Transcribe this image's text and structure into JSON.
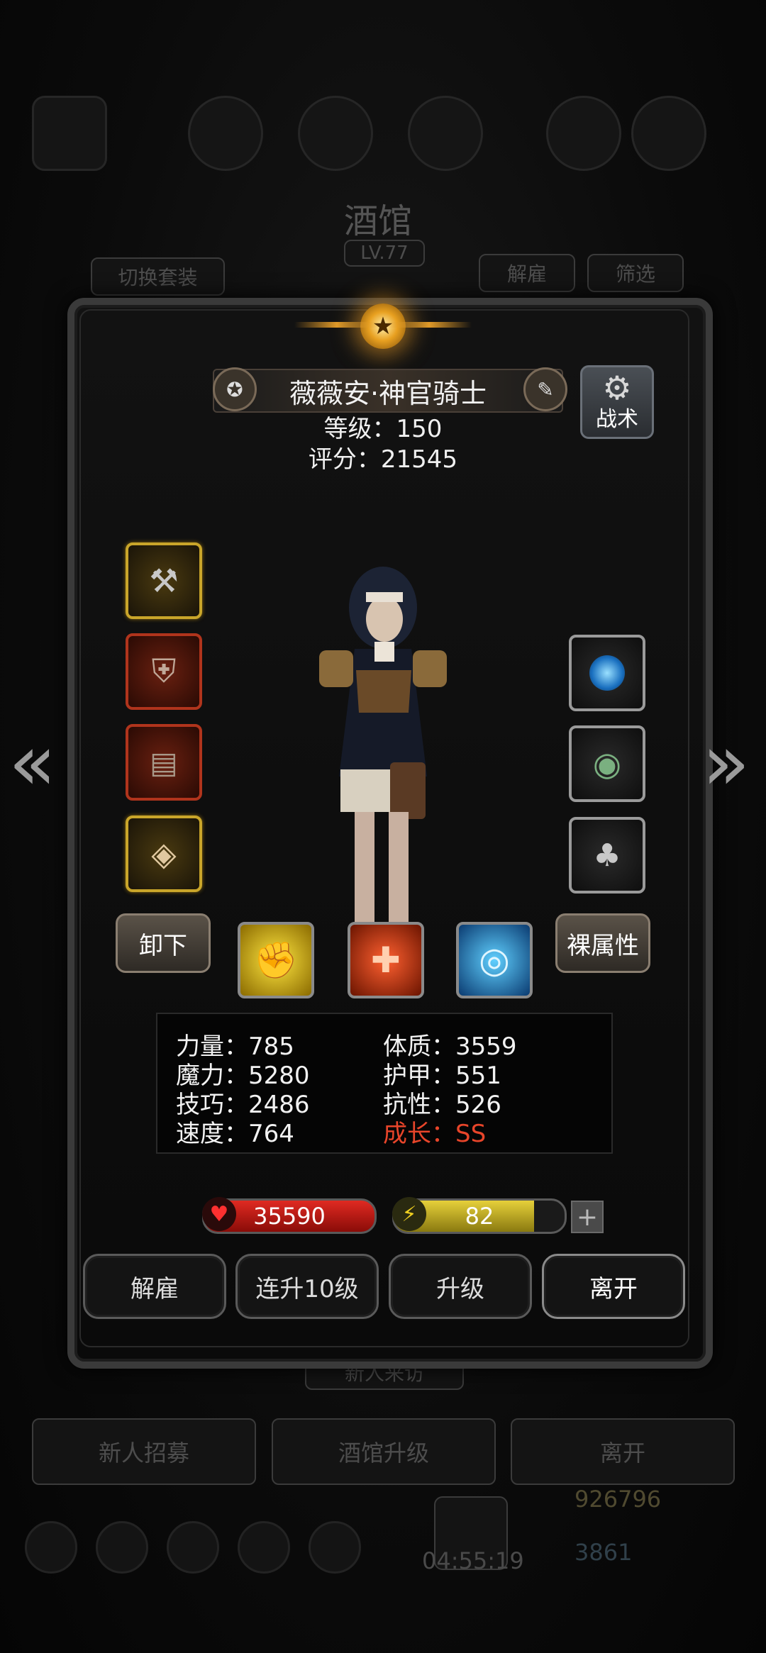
{
  "background": {
    "title": "酒馆",
    "level": "LV.77",
    "switch_outfit": "切换套装",
    "dismiss": "解雇",
    "filter": "筛选",
    "new_visitor": "新人来访",
    "recruit": "新人招募",
    "upgrade_tavern": "酒馆升级",
    "leave": "离开",
    "timer": "04:55:19",
    "gold": "926796",
    "gems": "3861"
  },
  "hero": {
    "name": "薇薇安·神官骑士",
    "level_text": "等级：150",
    "score_text": "评分：21545",
    "tactics_label": "战术"
  },
  "buttons": {
    "unequip": "卸下",
    "base_attributes": "裸属性"
  },
  "stats": {
    "strength": "力量：785",
    "constitution": "体质：3559",
    "magic": "魔力：5280",
    "armor": "护甲：551",
    "skill": "技巧：2486",
    "resistance": "抗性：526",
    "speed": "速度：764",
    "growth": "成长：SS"
  },
  "bars": {
    "hp": "35590",
    "energy": "82",
    "energy_fraction": 0.82
  },
  "actions": {
    "dismiss": "解雇",
    "upgrade_10": "连升10级",
    "upgrade": "升级",
    "leave": "离开"
  },
  "colors": {
    "growth": "#e8452a",
    "gold_border": "#c9a52a",
    "hp": "#e02a22",
    "energy": "#e6d03a"
  }
}
